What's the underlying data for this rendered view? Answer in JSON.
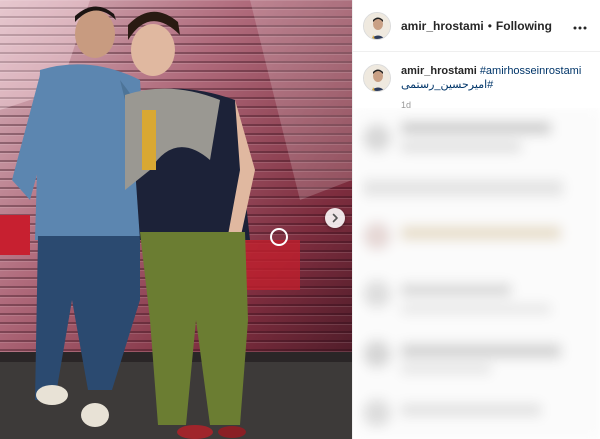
{
  "post": {
    "author": "amir_hrostami",
    "follow_status": "Following",
    "separator": "•",
    "caption": {
      "username": "amir_hrostami",
      "hashtag_en": "#amirhosseinrostami",
      "hashtag_fa": "#امیرحسین_رستمی"
    },
    "time": "1d"
  },
  "icons": {
    "more": "more-horizontal-icon",
    "next": "chevron-right-icon"
  }
}
